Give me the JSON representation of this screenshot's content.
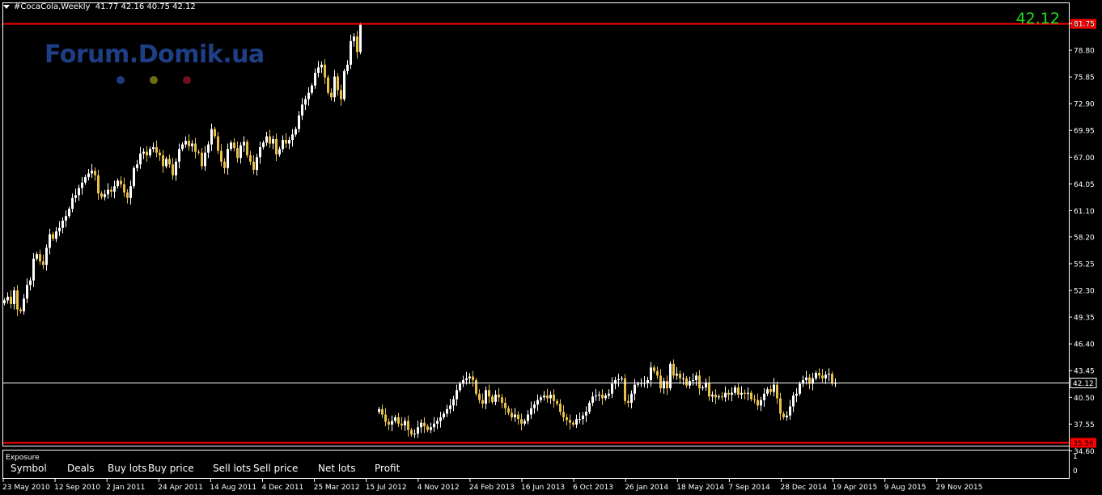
{
  "header": {
    "symbol": "#CocaCola,Weekly",
    "ohlc": "41.77 42.16 40.75 42.12"
  },
  "current_price_big": "42.12",
  "watermark": {
    "text": "Forum.Domik.ua",
    "dot_colors": [
      "#1c3d7a",
      "#6b6d14",
      "#6e1020"
    ]
  },
  "colors": {
    "background": "#000000",
    "bull_candle": "#ffffff",
    "bear_candle": "#e8c047",
    "level_line": "#ff0000",
    "bid_line": "#ffffff",
    "frame": "#ffffff"
  },
  "chart_data": {
    "type": "candlestick",
    "title": "#CocaCola,Weekly",
    "ylim": [
      33.82,
      82.8
    ],
    "y_ticks": [
      "81.75",
      "78.80",
      "75.85",
      "72.90",
      "69.95",
      "67.00",
      "64.05",
      "61.10",
      "58.20",
      "55.25",
      "52.30",
      "49.35",
      "46.40",
      "43.45",
      "40.50",
      "37.55",
      "34.60"
    ],
    "x_tick_labels": [
      "23 May 2010",
      "12 Sep 2010",
      "2 Jan 2011",
      "24 Apr 2011",
      "14 Aug 2011",
      "4 Dec 2011",
      "25 Mar 2012",
      "15 Jul 2012",
      "4 Nov 2012",
      "24 Feb 2013",
      "16 Jun 2013",
      "6 Oct 2013",
      "26 Jan 2014",
      "18 May 2014",
      "7 Sep 2014",
      "28 Dec 2014",
      "19 Apr 2015",
      "9 Aug 2015",
      "29 Nov 2015"
    ],
    "horizontal_levels": [
      {
        "price": 81.79,
        "label": "81.79",
        "color": "#ff0000"
      },
      {
        "price": 35.56,
        "label": "35.56",
        "color": "#ff0000"
      },
      {
        "price": 42.12,
        "label": "42.12",
        "color": "#ffffff"
      }
    ],
    "period_1": {
      "from": "23 May 2010",
      "to": "Aug 2012",
      "closes": [
        51.2,
        51.6,
        50.8,
        52.3,
        50.2,
        50.0,
        51.4,
        52.9,
        53.4,
        55.8,
        56.3,
        55.5,
        55.1,
        57.0,
        58.5,
        58.0,
        58.8,
        59.2,
        60.0,
        60.5,
        61.3,
        62.5,
        62.8,
        63.6,
        64.2,
        64.8,
        65.2,
        65.5,
        65.0,
        63.0,
        62.6,
        62.9,
        63.4,
        63.2,
        63.8,
        64.4,
        64.0,
        63.1,
        62.5,
        63.8,
        65.8,
        66.2,
        67.4,
        67.6,
        67.2,
        67.9,
        68.1,
        67.5,
        67.2,
        66.0,
        66.8,
        66.2,
        65.0,
        66.5,
        67.9,
        68.4,
        68.8,
        68.2,
        68.5,
        67.6,
        67.5,
        66.0,
        67.5,
        68.4,
        70.1,
        69.3,
        67.7,
        66.5,
        65.8,
        67.9,
        68.6,
        68.0,
        66.9,
        68.3,
        68.7,
        67.2,
        66.5,
        65.6,
        67.0,
        68.1,
        68.6,
        69.3,
        68.5,
        69.0,
        67.3,
        67.9,
        68.9,
        68.5,
        68.9,
        69.5,
        70.1,
        71.6,
        72.8,
        73.4,
        74.1,
        74.9,
        76.3,
        76.9,
        77.2,
        75.8,
        74.1,
        73.6,
        75.9,
        74.4,
        73.4,
        76.5,
        77.2,
        79.8,
        80.3,
        78.6,
        81.6
      ]
    },
    "period_2": {
      "from": "Aug 2012",
      "to": "Dec 2015",
      "closes": [
        39.2,
        38.6,
        37.8,
        37.5,
        37.9,
        38.3,
        37.6,
        37.4,
        37.9,
        36.9,
        36.4,
        36.5,
        37.2,
        37.7,
        37.3,
        36.9,
        37.2,
        37.6,
        37.9,
        38.3,
        38.7,
        39.2,
        39.6,
        40.3,
        41.3,
        42.0,
        42.4,
        42.6,
        42.8,
        42.4,
        40.9,
        40.2,
        39.8,
        41.3,
        40.6,
        40.0,
        40.8,
        40.5,
        39.9,
        39.3,
        38.8,
        38.3,
        38.6,
        38.1,
        37.6,
        37.9,
        38.6,
        39.3,
        39.7,
        40.2,
        40.5,
        40.7,
        40.4,
        40.8,
        40.1,
        39.8,
        38.9,
        38.3,
        38.0,
        37.7,
        37.5,
        38.1,
        38.1,
        38.5,
        38.9,
        39.9,
        40.6,
        40.7,
        40.8,
        40.4,
        40.7,
        40.9,
        42.0,
        42.4,
        42.5,
        42.6,
        40.1,
        39.9,
        40.9,
        41.9,
        42.0,
        42.1,
        42.1,
        42.4,
        43.8,
        43.4,
        42.9,
        41.5,
        42.3,
        41.5,
        44.2,
        42.9,
        43.1,
        42.6,
        42.6,
        41.8,
        42.3,
        42.4,
        42.9,
        41.5,
        41.6,
        42.1,
        40.6,
        40.8,
        40.5,
        40.6,
        40.5,
        41.0,
        40.8,
        41.0,
        41.6,
        40.8,
        41.0,
        40.9,
        41.0,
        40.3,
        40.2,
        39.6,
        40.2,
        40.9,
        41.4,
        41.1,
        41.9,
        40.4,
        38.7,
        38.3,
        38.5,
        39.5,
        40.7,
        40.9,
        42.0,
        42.4,
        42.7,
        42.0,
        42.6,
        43.2,
        42.9,
        42.6,
        43.0,
        43.1,
        42.0,
        42.1
      ]
    }
  },
  "exposure": {
    "title": "Exposure",
    "columns": [
      "Symbol",
      "Deals",
      "Buy lots",
      "Buy price",
      "Sell lots",
      "Sell price",
      "Net lots",
      "Profit"
    ],
    "scale_top": "1",
    "scale_bottom": "0"
  }
}
